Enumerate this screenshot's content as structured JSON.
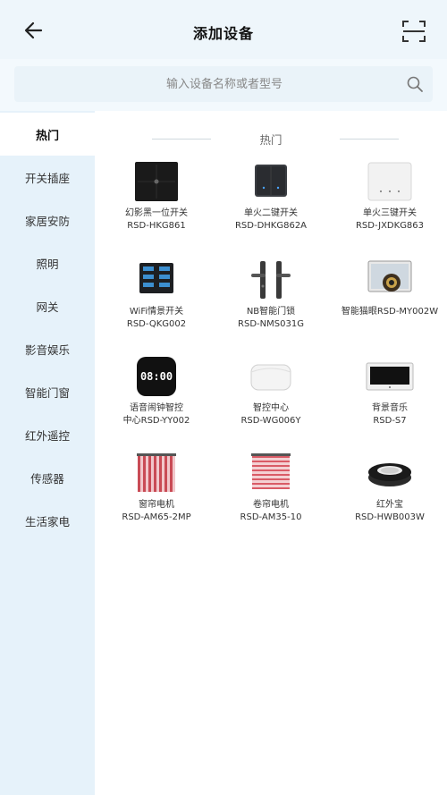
{
  "header": {
    "title": "添加设备"
  },
  "search": {
    "placeholder": "输入设备名称或者型号"
  },
  "sidebar": {
    "items": [
      {
        "label": "热门",
        "active": true
      },
      {
        "label": "开关插座",
        "active": false
      },
      {
        "label": "家居安防",
        "active": false
      },
      {
        "label": "照明",
        "active": false
      },
      {
        "label": "网关",
        "active": false
      },
      {
        "label": "影音娱乐",
        "active": false
      },
      {
        "label": "智能门窗",
        "active": false
      },
      {
        "label": "红外遥控",
        "active": false
      },
      {
        "label": "传感器",
        "active": false
      },
      {
        "label": "生活家电",
        "active": false
      }
    ]
  },
  "main": {
    "section_title": "热门",
    "products": [
      {
        "name": "幻影黑一位开关",
        "model": "RSD-HKG861",
        "icon": "black-switch-icon"
      },
      {
        "name": "单火二键开关",
        "model": "RSD-DHKG862A",
        "icon": "dark-two-key-switch-icon"
      },
      {
        "name": "单火三键开关",
        "model": "RSD-JXDKG863",
        "icon": "white-three-key-switch-icon"
      },
      {
        "name": "WiFi情景开关",
        "model": "RSD-QKG002",
        "icon": "scene-switch-icon"
      },
      {
        "name": "NB智能门锁",
        "model": "RSD-NMS031G",
        "icon": "door-lock-icon"
      },
      {
        "name": "",
        "model": "智能猫眼RSD-MY002W",
        "icon": "peephole-camera-icon"
      },
      {
        "name": "语音闹钟智控",
        "model": "中心RSD-YY002",
        "icon": "alarm-clock-icon",
        "clock_text": "08:00"
      },
      {
        "name": "智控中心",
        "model": "RSD-WG006Y",
        "icon": "hub-icon"
      },
      {
        "name": "背景音乐",
        "model": "RSD-S7",
        "icon": "music-panel-icon"
      },
      {
        "name": "窗帘电机",
        "model": "RSD-AM65-2MP",
        "icon": "curtain-icon"
      },
      {
        "name": "卷帘电机",
        "model": "RSD-AM35-10",
        "icon": "roller-blind-icon"
      },
      {
        "name": "红外宝",
        "model": "RSD-HWB003W",
        "icon": "ir-blaster-icon"
      }
    ]
  }
}
